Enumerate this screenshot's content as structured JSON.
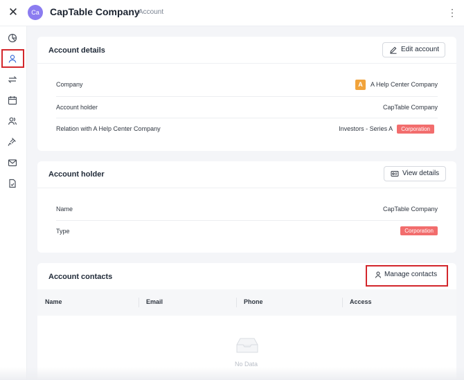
{
  "header": {
    "avatar_initials": "Ca",
    "title": "CapTable Company",
    "subtitle": "Account"
  },
  "sidebar": {
    "items": [
      {
        "icon": "pie-chart-icon"
      },
      {
        "icon": "user-icon",
        "active": true
      },
      {
        "icon": "transfer-arrows-icon"
      },
      {
        "icon": "calendar-icon"
      },
      {
        "icon": "users-icon"
      },
      {
        "icon": "gavel-icon"
      },
      {
        "icon": "mail-icon"
      },
      {
        "icon": "document-icon"
      }
    ]
  },
  "account_details": {
    "title": "Account details",
    "edit_label": "Edit account",
    "rows": [
      {
        "label": "Company",
        "badge": "A",
        "value": "A Help Center Company"
      },
      {
        "label": "Account holder",
        "value": "CapTable Company"
      },
      {
        "label": "Relation with A Help Center Company",
        "value": "Investors - Series A",
        "tag": "Corporation"
      }
    ]
  },
  "account_holder": {
    "title": "Account holder",
    "view_label": "View details",
    "rows": [
      {
        "label": "Name",
        "value": "CapTable Company"
      },
      {
        "label": "Type",
        "tag": "Corporation"
      }
    ]
  },
  "account_contacts": {
    "title": "Account contacts",
    "manage_label": "Manage contacts",
    "columns": [
      "Name",
      "Email",
      "Phone",
      "Access"
    ],
    "empty_text": "No Data"
  },
  "colors": {
    "accent_avatar": "#8b7cf0",
    "company_badge": "#f1a33b",
    "tag": "#f26d6d",
    "highlight": "#d3262b"
  }
}
